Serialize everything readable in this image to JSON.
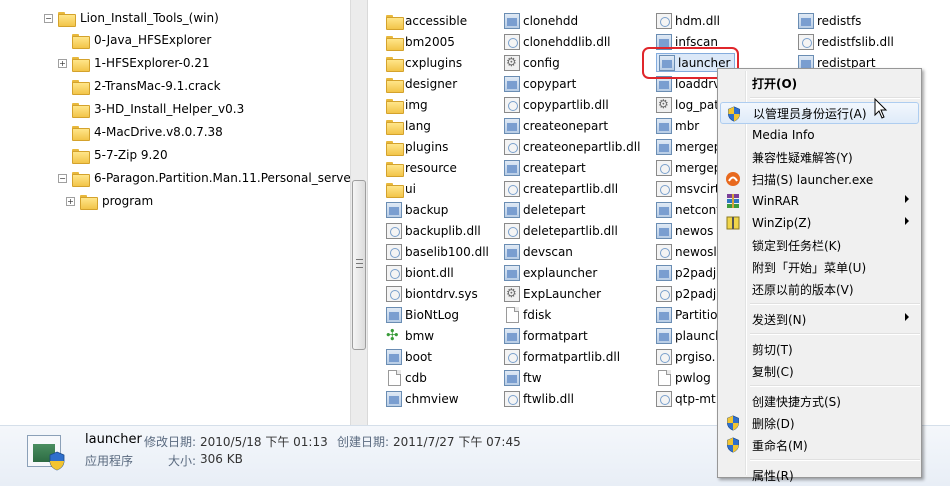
{
  "tree": {
    "items": [
      {
        "label": "Lion_Install_Tools_(win)",
        "expander": "−"
      },
      {
        "label": "0-Java_HFSExplorer",
        "expander": ""
      },
      {
        "label": "1-HFSExplorer-0.21",
        "expander": "+"
      },
      {
        "label": "2-TransMac-9.1.crack",
        "expander": ""
      },
      {
        "label": "3-HD_Install_Helper_v0.3",
        "expander": ""
      },
      {
        "label": "4-MacDrive.v8.0.7.38",
        "expander": ""
      },
      {
        "label": "5-7-Zip 9.20",
        "expander": ""
      },
      {
        "label": "6-Paragon.Partition.Man.11.Personal_server",
        "expander": "−"
      },
      {
        "label": "program",
        "expander": "+"
      }
    ]
  },
  "files": {
    "col1": [
      {
        "name": "accessible",
        "icon": "folder-icon"
      },
      {
        "name": "bm2005",
        "icon": "folder-icon"
      },
      {
        "name": "cxplugins",
        "icon": "folder-icon"
      },
      {
        "name": "designer",
        "icon": "folder-icon"
      },
      {
        "name": "img",
        "icon": "folder-icon"
      },
      {
        "name": "lang",
        "icon": "folder-icon"
      },
      {
        "name": "plugins",
        "icon": "folder-icon"
      },
      {
        "name": "resource",
        "icon": "folder-icon"
      },
      {
        "name": "ui",
        "icon": "folder-icon"
      },
      {
        "name": "backup",
        "icon": "exe-icon"
      },
      {
        "name": "backuplib.dll",
        "icon": "dll-icon"
      },
      {
        "name": "baselib100.dll",
        "icon": "dll-icon"
      },
      {
        "name": "biont.dll",
        "icon": "dll-icon"
      },
      {
        "name": "biontdrv.sys",
        "icon": "dll-icon"
      },
      {
        "name": "BioNtLog",
        "icon": "exe-icon"
      },
      {
        "name": "bmw",
        "icon": "bmw-icon"
      },
      {
        "name": "boot",
        "icon": "exe-icon"
      },
      {
        "name": "cdb",
        "icon": "doc-icon"
      },
      {
        "name": "chmview",
        "icon": "exe-icon"
      }
    ],
    "col2": [
      {
        "name": "clonehdd",
        "icon": "exe-icon"
      },
      {
        "name": "clonehddlib.dll",
        "icon": "dll-icon"
      },
      {
        "name": "config",
        "icon": "config-icon"
      },
      {
        "name": "copypart",
        "icon": "exe-icon"
      },
      {
        "name": "copypartlib.dll",
        "icon": "dll-icon"
      },
      {
        "name": "createonepart",
        "icon": "exe-icon"
      },
      {
        "name": "createonepartlib.dll",
        "icon": "dll-icon"
      },
      {
        "name": "createpart",
        "icon": "exe-icon"
      },
      {
        "name": "createpartlib.dll",
        "icon": "dll-icon"
      },
      {
        "name": "deletepart",
        "icon": "exe-icon"
      },
      {
        "name": "deletepartlib.dll",
        "icon": "dll-icon"
      },
      {
        "name": "devscan",
        "icon": "exe-icon"
      },
      {
        "name": "explauncher",
        "icon": "exe-icon"
      },
      {
        "name": "ExpLauncher",
        "icon": "config-icon"
      },
      {
        "name": "fdisk",
        "icon": "doc-icon"
      },
      {
        "name": "formatpart",
        "icon": "exe-icon"
      },
      {
        "name": "formatpartlib.dll",
        "icon": "dll-icon"
      },
      {
        "name": "ftw",
        "icon": "exe-icon"
      },
      {
        "name": "ftwlib.dll",
        "icon": "dll-icon"
      }
    ],
    "col3": [
      {
        "name": "hdm.dll",
        "icon": "dll-icon"
      },
      {
        "name": "infscan",
        "icon": "exe-icon"
      },
      {
        "name": "launcher",
        "icon": "exe-icon"
      },
      {
        "name": "loaddrv",
        "icon": "exe-icon"
      },
      {
        "name": "log_pat",
        "icon": "config-icon"
      },
      {
        "name": "mbr",
        "icon": "exe-icon"
      },
      {
        "name": "mergep",
        "icon": "exe-icon"
      },
      {
        "name": "mergep",
        "icon": "dll-icon"
      },
      {
        "name": "msvcirt",
        "icon": "dll-icon"
      },
      {
        "name": "netconf",
        "icon": "exe-icon"
      },
      {
        "name": "newos",
        "icon": "exe-icon"
      },
      {
        "name": "newosli",
        "icon": "dll-icon"
      },
      {
        "name": "p2padj",
        "icon": "exe-icon"
      },
      {
        "name": "p2padj",
        "icon": "dll-icon"
      },
      {
        "name": "Partitio",
        "icon": "exe-icon"
      },
      {
        "name": "plaunch",
        "icon": "exe-icon"
      },
      {
        "name": "prgiso.",
        "icon": "dll-icon"
      },
      {
        "name": "pwlog",
        "icon": "doc-icon"
      },
      {
        "name": "qtp-mt",
        "icon": "dll-icon"
      }
    ],
    "col4": [
      {
        "name": "redistfs",
        "icon": "exe-icon"
      },
      {
        "name": "redistfslib.dll",
        "icon": "dll-icon"
      },
      {
        "name": "redistpart",
        "icon": "exe-icon"
      }
    ]
  },
  "context_menu": {
    "items": [
      {
        "label": "打开(O)",
        "bold": true,
        "icon": "",
        "submenu": false
      },
      {
        "label": "以管理员身份运行(A)",
        "bold": false,
        "icon": "uac-shield-icon",
        "submenu": false,
        "hover": true
      },
      {
        "label": "Media Info",
        "bold": false,
        "icon": "",
        "submenu": false
      },
      {
        "label": "兼容性疑难解答(Y)",
        "bold": false,
        "icon": "",
        "submenu": false
      },
      {
        "label": "扫描(S) launcher.exe",
        "bold": false,
        "icon": "antivirus-icon",
        "submenu": false
      },
      {
        "label": "WinRAR",
        "bold": false,
        "icon": "winrar-icon",
        "submenu": true
      },
      {
        "label": "WinZip(Z)",
        "bold": false,
        "icon": "winzip-icon",
        "submenu": true
      },
      {
        "label": "锁定到任务栏(K)",
        "bold": false,
        "icon": "",
        "submenu": false
      },
      {
        "label": "附到「开始」菜单(U)",
        "bold": false,
        "icon": "",
        "submenu": false
      },
      {
        "label": "还原以前的版本(V)",
        "bold": false,
        "icon": "",
        "submenu": false
      },
      {
        "label": "发送到(N)",
        "bold": false,
        "icon": "",
        "submenu": true
      },
      {
        "label": "剪切(T)",
        "bold": false,
        "icon": "",
        "submenu": false
      },
      {
        "label": "复制(C)",
        "bold": false,
        "icon": "",
        "submenu": false
      },
      {
        "label": "创建快捷方式(S)",
        "bold": false,
        "icon": "",
        "submenu": false
      },
      {
        "label": "删除(D)",
        "bold": false,
        "icon": "uac-shield-icon",
        "submenu": false
      },
      {
        "label": "重命名(M)",
        "bold": false,
        "icon": "uac-shield-icon",
        "submenu": false
      },
      {
        "label": "属性(R)",
        "bold": false,
        "icon": "",
        "submenu": false
      }
    ]
  },
  "status": {
    "name": "launcher",
    "modified_label": "修改日期:",
    "modified_value": "2010/5/18 下午 01:13",
    "created_label": "创建日期:",
    "created_value": "2011/7/27 下午 07:45",
    "type": "应用程序",
    "size_label": "大小:",
    "size_value": "306 KB"
  },
  "colors": {
    "highlight_ring": "#e0262b",
    "menu_hover": "#dfebf9",
    "folder_yellow": "#f2c449"
  }
}
